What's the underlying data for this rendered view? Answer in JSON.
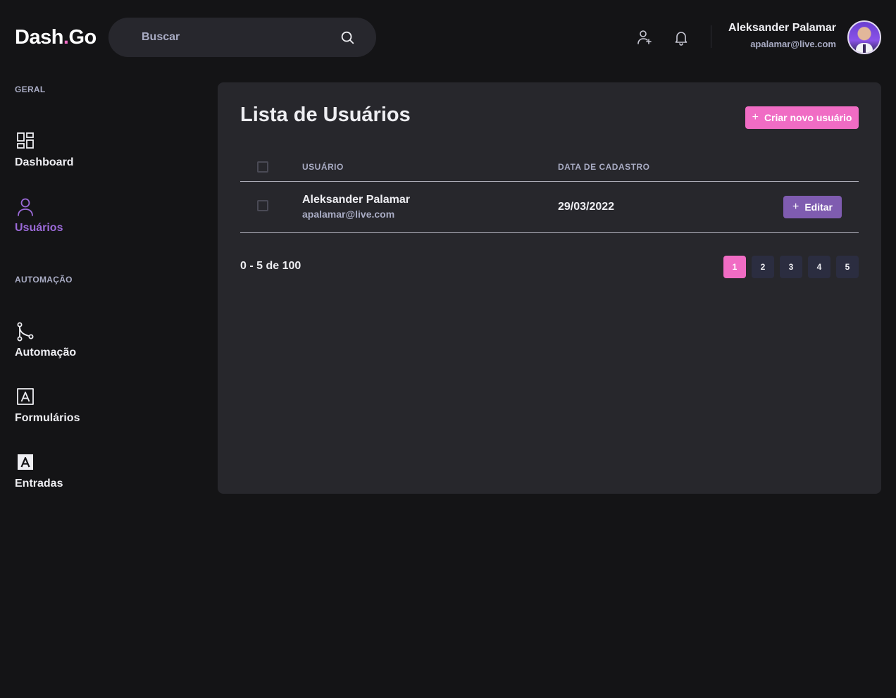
{
  "header": {
    "logo_main": "Dash",
    "logo_dot": ".",
    "logo_end": "Go",
    "search_placeholder": "Buscar",
    "user_name": "Aleksander Palamar",
    "user_email": "apalamar@live.com"
  },
  "sidebar": {
    "sections": [
      {
        "title": "GERAL",
        "items": [
          {
            "label": "Dashboard",
            "icon": "dashboard-icon",
            "active": false
          },
          {
            "label": "Usuários",
            "icon": "user-icon",
            "active": true
          }
        ]
      },
      {
        "title": "AUTOMAÇÃO",
        "items": [
          {
            "label": "Automação",
            "icon": "git-merge-icon",
            "active": false
          },
          {
            "label": "Formulários",
            "icon": "form-icon",
            "active": false
          },
          {
            "label": "Entradas",
            "icon": "input-icon",
            "active": false
          }
        ]
      }
    ]
  },
  "main": {
    "title": "Lista de Usuários",
    "create_button": "Criar novo usuário",
    "table": {
      "headers": [
        "USUÁRIO",
        "DATA DE CADASTRO"
      ],
      "rows": [
        {
          "name": "Aleksander Palamar",
          "email": "apalamar@live.com",
          "date": "29/03/2022",
          "action": "Editar"
        }
      ]
    },
    "pagination": {
      "range": "0 - 5 de 100",
      "pages": [
        "1",
        "2",
        "3",
        "4",
        "5"
      ],
      "current": "1"
    }
  },
  "colors": {
    "background": "#141416",
    "surface": "#27272c",
    "pink": "#f06cc4",
    "purple": "#7f5cb0",
    "active_nav": "#9b6ad8",
    "muted_text": "#a9acc4"
  }
}
